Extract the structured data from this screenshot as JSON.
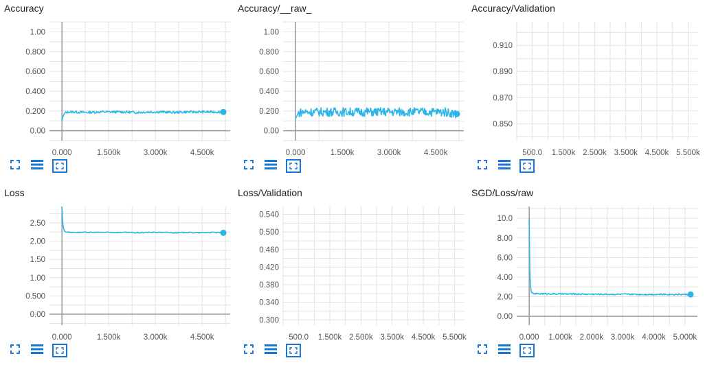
{
  "colors": {
    "series": "#2fb6e8",
    "grid": "#e2e2e2",
    "axis": "#999999",
    "icon": "#1976d2"
  },
  "icons": [
    "fullscreen-icon",
    "data-table-icon",
    "fit-domain-icon"
  ],
  "chart_data": [
    {
      "id": "accuracy",
      "type": "line",
      "title": "Accuracy",
      "xlabel": "",
      "ylabel": "",
      "xlim": [
        -400,
        5400
      ],
      "ylim": [
        -0.1,
        1.1
      ],
      "xticks": [
        0,
        1500,
        3000,
        4500
      ],
      "xtick_labels": [
        "0.000",
        "1.500k",
        "3.000k",
        "4.500k"
      ],
      "yticks": [
        0,
        0.2,
        0.4,
        0.6,
        0.8,
        1.0
      ],
      "ytick_labels": [
        "0.00",
        "0.200",
        "0.400",
        "0.600",
        "0.800",
        "1.00"
      ],
      "axis_line_x": 0,
      "axis_line_y": 0,
      "series": [
        {
          "x": [
            0,
            40,
            100,
            200,
            400,
            800,
            1200,
            1600,
            2000,
            2400,
            2800,
            3200,
            3600,
            4000,
            4400,
            4800,
            5180
          ],
          "y": [
            0.1,
            0.15,
            0.18,
            0.19,
            0.19,
            0.185,
            0.19,
            0.19,
            0.19,
            0.185,
            0.19,
            0.19,
            0.185,
            0.19,
            0.19,
            0.19,
            0.19
          ],
          "noise": 0.012
        }
      ]
    },
    {
      "id": "accuracy-raw",
      "type": "line",
      "title": "Accuracy/__raw_",
      "xlabel": "",
      "ylabel": "",
      "xlim": [
        -400,
        5400
      ],
      "ylim": [
        -0.1,
        1.1
      ],
      "xticks": [
        0,
        1500,
        3000,
        4500
      ],
      "xtick_labels": [
        "0.000",
        "1.500k",
        "3.000k",
        "4.500k"
      ],
      "yticks": [
        0,
        0.2,
        0.4,
        0.6,
        0.8,
        1.0
      ],
      "ytick_labels": [
        "0.00",
        "0.200",
        "0.400",
        "0.600",
        "0.800",
        "1.00"
      ],
      "axis_line_x": 0,
      "axis_line_y": 0,
      "series": [
        {
          "x": [
            0,
            40,
            100,
            200,
            400,
            800,
            1200,
            1600,
            2000,
            2400,
            2800,
            3200,
            3600,
            4000,
            4400,
            4800,
            5180
          ],
          "y": [
            0.12,
            0.15,
            0.18,
            0.19,
            0.19,
            0.19,
            0.19,
            0.19,
            0.19,
            0.19,
            0.19,
            0.19,
            0.19,
            0.19,
            0.19,
            0.19,
            0.17
          ],
          "noise": 0.045
        }
      ]
    },
    {
      "id": "accuracy-validation",
      "type": "line",
      "title": "Accuracy/Validation",
      "xlabel": "",
      "ylabel": "",
      "xlim": [
        0,
        5800
      ],
      "ylim": [
        0.837,
        0.928
      ],
      "xticks": [
        500,
        1500,
        2500,
        3500,
        4500,
        5500
      ],
      "xtick_labels": [
        "500.0",
        "1.500k",
        "2.500k",
        "3.500k",
        "4.500k",
        "5.500k"
      ],
      "yticks": [
        0.85,
        0.87,
        0.89,
        0.91
      ],
      "ytick_labels": [
        "0.850",
        "0.870",
        "0.890",
        "0.910"
      ],
      "axis_line_x": null,
      "axis_line_y": null,
      "series": []
    },
    {
      "id": "loss",
      "type": "line",
      "title": "Loss",
      "xlabel": "",
      "ylabel": "",
      "xlim": [
        -400,
        5400
      ],
      "ylim": [
        -0.3,
        2.95
      ],
      "xticks": [
        0,
        1500,
        3000,
        4500
      ],
      "xtick_labels": [
        "0.000",
        "1.500k",
        "3.000k",
        "4.500k"
      ],
      "yticks": [
        0,
        0.5,
        1.0,
        1.5,
        2.0,
        2.5
      ],
      "ytick_labels": [
        "0.00",
        "0.500",
        "1.00",
        "1.50",
        "2.00",
        "2.50"
      ],
      "axis_line_x": 0,
      "axis_line_y": 0,
      "series": [
        {
          "x": [
            0,
            20,
            40,
            70,
            100,
            150,
            200,
            300,
            500,
            800,
            1200,
            1600,
            2000,
            2400,
            2800,
            3200,
            3600,
            4000,
            4400,
            4800,
            5180
          ],
          "y": [
            2.95,
            2.6,
            2.4,
            2.3,
            2.26,
            2.25,
            2.25,
            2.24,
            2.24,
            2.24,
            2.24,
            2.24,
            2.24,
            2.23,
            2.24,
            2.24,
            2.23,
            2.24,
            2.23,
            2.24,
            2.23
          ],
          "noise": 0.012
        }
      ]
    },
    {
      "id": "loss-validation",
      "type": "line",
      "title": "Loss/Validation",
      "xlabel": "",
      "ylabel": "",
      "xlim": [
        0,
        5800
      ],
      "ylim": [
        0.288,
        0.558
      ],
      "xticks": [
        500,
        1500,
        2500,
        3500,
        4500,
        5500
      ],
      "xtick_labels": [
        "500.0",
        "1.500k",
        "2.500k",
        "3.500k",
        "4.500k",
        "5.500k"
      ],
      "yticks": [
        0.3,
        0.34,
        0.38,
        0.42,
        0.46,
        0.5,
        0.54
      ],
      "ytick_labels": [
        "0.300",
        "0.340",
        "0.380",
        "0.420",
        "0.460",
        "0.500",
        "0.540"
      ],
      "axis_line_x": null,
      "axis_line_y": null,
      "series": []
    },
    {
      "id": "sgd-loss-raw",
      "type": "line",
      "title": "SGD/Loss/raw",
      "xlabel": "",
      "ylabel": "",
      "xlim": [
        -400,
        5400
      ],
      "ylim": [
        -0.9,
        11.2
      ],
      "xticks": [
        0,
        1000,
        2000,
        3000,
        4000,
        5000
      ],
      "xtick_labels": [
        "0.000",
        "1.000k",
        "2.000k",
        "3.000k",
        "4.000k",
        "5.000k"
      ],
      "yticks": [
        0,
        2,
        4,
        6,
        8,
        10
      ],
      "ytick_labels": [
        "0.00",
        "2.00",
        "4.00",
        "6.00",
        "8.00",
        "10.0"
      ],
      "axis_line_x": 0,
      "axis_line_y": 0,
      "series": [
        {
          "x": [
            0,
            10,
            20,
            40,
            60,
            100,
            150,
            250,
            500,
            1000,
            1500,
            2000,
            2500,
            3000,
            3500,
            4000,
            4500,
            5000,
            5180
          ],
          "y": [
            10.0,
            8.0,
            5.0,
            3.2,
            2.6,
            2.35,
            2.3,
            2.3,
            2.3,
            2.28,
            2.27,
            2.26,
            2.25,
            2.25,
            2.24,
            2.24,
            2.24,
            2.24,
            2.23
          ],
          "noise": 0.07
        }
      ]
    }
  ]
}
